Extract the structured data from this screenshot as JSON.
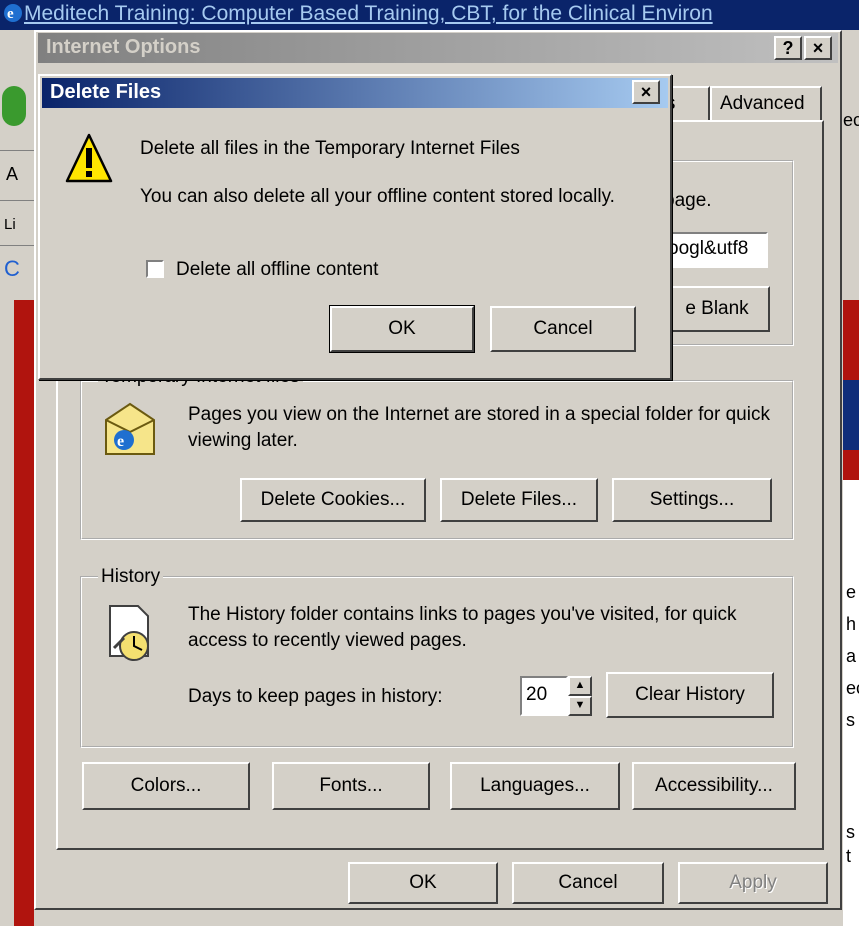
{
  "background_window": {
    "title": "Meditech Training: Computer Based Training, CBT, for the Clinical Environ",
    "left_letters": [
      "A",
      "Li",
      "C"
    ],
    "right_letters": [
      "ec",
      "e",
      "h",
      "a",
      "ec",
      "s",
      "s",
      "t"
    ]
  },
  "internet_options": {
    "title": "Internet Options",
    "help_btn": "?",
    "close_btn": "×",
    "tabs": {
      "programs_partial": "ms",
      "advanced": "Advanced"
    },
    "home_page": {
      "text_partial": "page.",
      "address_partial": "oogl&utf8",
      "use_blank_partial": "e Blank"
    },
    "temp_files": {
      "legend": "Temporary Internet files",
      "description": "Pages you view on the Internet are stored in a special folder for quick viewing later.",
      "delete_cookies": "Delete Cookies...",
      "delete_files": "Delete Files...",
      "settings": "Settings..."
    },
    "history": {
      "legend": "History",
      "description": "The History folder contains links to pages you've visited, for quick access to recently viewed pages.",
      "days_label": "Days to keep pages in history:",
      "days_value": "20",
      "clear_history": "Clear History"
    },
    "bottom_buttons": {
      "colors": "Colors...",
      "fonts": "Fonts...",
      "languages": "Languages...",
      "accessibility": "Accessibility..."
    },
    "footer": {
      "ok": "OK",
      "cancel": "Cancel",
      "apply": "Apply"
    }
  },
  "delete_files_dialog": {
    "title": "Delete Files",
    "close_btn": "×",
    "message": "Delete all files in the Temporary Internet Files",
    "sub_message": "You can also delete all your offline content stored locally.",
    "checkbox_label": "Delete all offline content",
    "checkbox_checked": false,
    "ok": "OK",
    "cancel": "Cancel"
  },
  "icons": [
    "ie-icon",
    "warning-icon",
    "temp-files-folder-icon",
    "history-icon",
    "spinner-up-icon",
    "spinner-down-icon"
  ],
  "colors": {
    "dialog_title_start": "#0a246a",
    "dialog_title_end": "#a6caf0",
    "window_face": "#d4d0c8",
    "page_red": "#b0140e"
  }
}
